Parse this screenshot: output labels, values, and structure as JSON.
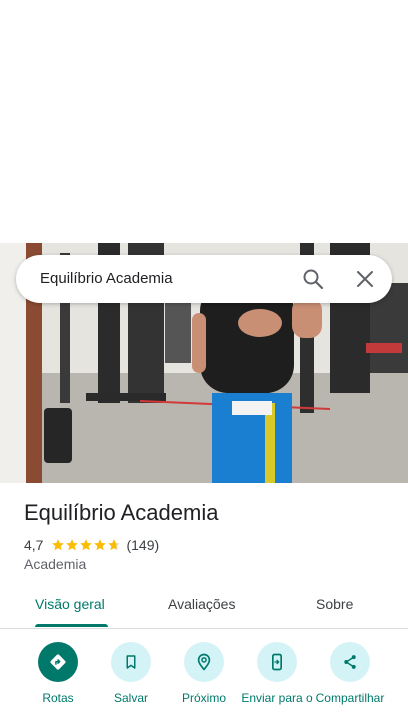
{
  "search": {
    "query": "Equilíbrio Academia"
  },
  "place": {
    "name": "Equilíbrio Academia",
    "rating": "4,7",
    "stars": 4.7,
    "reviews": "(149)",
    "category": "Academia"
  },
  "tabs": [
    {
      "label": "Visão geral",
      "active": true
    },
    {
      "label": "Avaliações",
      "active": false
    },
    {
      "label": "Sobre",
      "active": false
    }
  ],
  "actions": [
    {
      "label": "Rotas",
      "icon": "directions-icon"
    },
    {
      "label": "Salvar",
      "icon": "bookmark-icon"
    },
    {
      "label": "Próximo",
      "icon": "nearby-icon"
    },
    {
      "label": "Enviar para o",
      "icon": "send-to-phone-icon"
    },
    {
      "label": "Compartilhar",
      "icon": "share-icon"
    }
  ],
  "colors": {
    "accent": "#00796b",
    "chip": "#d3f3f7",
    "star": "#fbbc04"
  }
}
